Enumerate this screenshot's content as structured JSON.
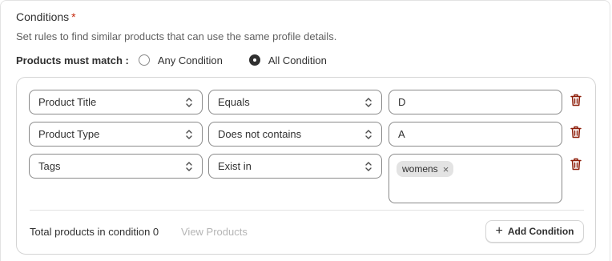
{
  "section": {
    "title": "Conditions",
    "required_mark": "*",
    "description": "Set rules to find similar products that can use the same profile details."
  },
  "match": {
    "label": "Products must match :",
    "options": [
      {
        "label": "Any Condition",
        "selected": false
      },
      {
        "label": "All Condition",
        "selected": true
      }
    ]
  },
  "conditions": [
    {
      "field": "Product Title",
      "operator": "Equals",
      "value": "D"
    },
    {
      "field": "Product Type",
      "operator": "Does not contains",
      "value": "A"
    },
    {
      "field": "Tags",
      "operator": "Exist in",
      "tags": [
        "womens"
      ]
    }
  ],
  "footer": {
    "total_label": "Total products in condition 0",
    "view_products": "View Products",
    "add_condition": "Add Condition",
    "add_icon": "+"
  },
  "icons": {
    "delete": "trash-icon",
    "select": "chevron-up-down-icon",
    "remove_tag": "×"
  },
  "colors": {
    "required": "#c5280c",
    "delete_icon": "#8e1f0b",
    "muted_link": "#b5b5b5"
  }
}
